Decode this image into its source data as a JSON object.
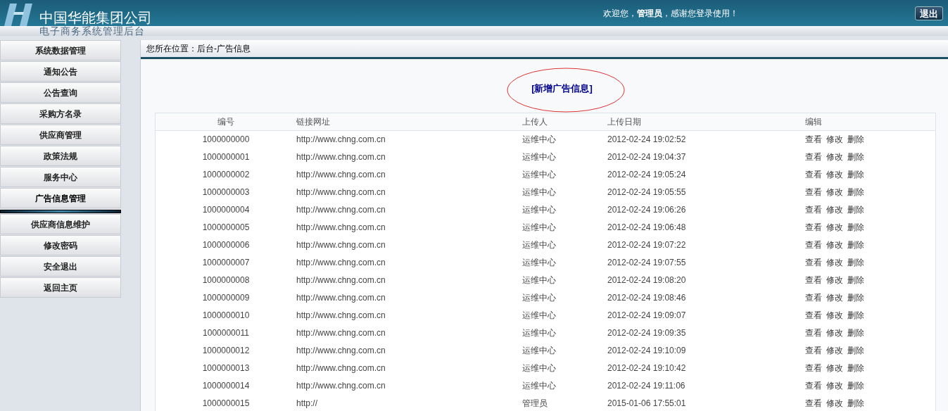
{
  "header": {
    "company": "中国华能集团公司",
    "subtitle": "电子商务系统管理后台",
    "welcome_before": "欢迎您，",
    "user": "管理员",
    "welcome_after": "，感谢您登录使用！",
    "logout": "退出"
  },
  "sidebar": {
    "items": [
      {
        "label": "系统数据管理",
        "selected": false
      },
      {
        "label": "通知公告",
        "selected": false
      },
      {
        "label": "公告查询",
        "selected": false
      },
      {
        "label": "采购方名录",
        "selected": false
      },
      {
        "label": "供应商管理",
        "selected": false
      },
      {
        "label": "政策法规",
        "selected": false
      },
      {
        "label": "服务中心",
        "selected": false
      },
      {
        "label": "广告信息管理",
        "selected": true
      },
      {
        "label": "供应商信息维护",
        "selected": false
      },
      {
        "label": "修改密码",
        "selected": false
      },
      {
        "label": "安全退出",
        "selected": false
      },
      {
        "label": "返回主页",
        "selected": false
      }
    ]
  },
  "breadcrumb": "您所在位置：后台-广告信息",
  "add_link": "[新增广告信息]",
  "table": {
    "columns": [
      "编号",
      "链接网址",
      "上传人",
      "上传日期",
      "编辑"
    ],
    "rows": [
      {
        "cells": [
          "1000000000",
          "http://www.chng.com.cn",
          "运维中心",
          "2012-02-24 19:02:52"
        ],
        "actions": [
          "查看",
          "修改",
          "删除"
        ]
      },
      {
        "cells": [
          "1000000001",
          "http://www.chng.com.cn",
          "运维中心",
          "2012-02-24 19:04:37"
        ],
        "actions": [
          "查看",
          "修改",
          "删除"
        ]
      },
      {
        "cells": [
          "1000000002",
          "http://www.chng.com.cn",
          "运维中心",
          "2012-02-24 19:05:24"
        ],
        "actions": [
          "查看",
          "修改",
          "删除"
        ]
      },
      {
        "cells": [
          "1000000003",
          "http://www.chng.com.cn",
          "运维中心",
          "2012-02-24 19:05:55"
        ],
        "actions": [
          "查看",
          "修改",
          "删除"
        ]
      },
      {
        "cells": [
          "1000000004",
          "http://www.chng.com.cn",
          "运维中心",
          "2012-02-24 19:06:26"
        ],
        "actions": [
          "查看",
          "修改",
          "删除"
        ]
      },
      {
        "cells": [
          "1000000005",
          "http://www.chng.com.cn",
          "运维中心",
          "2012-02-24 19:06:48"
        ],
        "actions": [
          "查看",
          "修改",
          "删除"
        ]
      },
      {
        "cells": [
          "1000000006",
          "http://www.chng.com.cn",
          "运维中心",
          "2012-02-24 19:07:22"
        ],
        "actions": [
          "查看",
          "修改",
          "删除"
        ]
      },
      {
        "cells": [
          "1000000007",
          "http://www.chng.com.cn",
          "运维中心",
          "2012-02-24 19:07:55"
        ],
        "actions": [
          "查看",
          "修改",
          "删除"
        ]
      },
      {
        "cells": [
          "1000000008",
          "http://www.chng.com.cn",
          "运维中心",
          "2012-02-24 19:08:20"
        ],
        "actions": [
          "查看",
          "修改",
          "删除"
        ]
      },
      {
        "cells": [
          "1000000009",
          "http://www.chng.com.cn",
          "运维中心",
          "2012-02-24 19:08:46"
        ],
        "actions": [
          "查看",
          "修改",
          "删除"
        ]
      },
      {
        "cells": [
          "1000000010",
          "http://www.chng.com.cn",
          "运维中心",
          "2012-02-24 19:09:07"
        ],
        "actions": [
          "查看",
          "修改",
          "删除"
        ]
      },
      {
        "cells": [
          "1000000011",
          "http://www.chng.com.cn",
          "运维中心",
          "2012-02-24 19:09:35"
        ],
        "actions": [
          "查看",
          "修改",
          "删除"
        ]
      },
      {
        "cells": [
          "1000000012",
          "http://www.chng.com.cn",
          "运维中心",
          "2012-02-24 19:10:09"
        ],
        "actions": [
          "查看",
          "修改",
          "删除"
        ]
      },
      {
        "cells": [
          "1000000013",
          "http://www.chng.com.cn",
          "运维中心",
          "2012-02-24 19:10:42"
        ],
        "actions": [
          "查看",
          "修改",
          "删除"
        ]
      },
      {
        "cells": [
          "1000000014",
          "http://www.chng.com.cn",
          "运维中心",
          "2012-02-24 19:11:06"
        ],
        "actions": [
          "查看",
          "修改",
          "删除"
        ]
      },
      {
        "cells": [
          "1000000015",
          "http://",
          "管理员",
          "2015-01-06 17:55:01"
        ],
        "actions": [
          "查看",
          "修改",
          "删除"
        ]
      }
    ]
  }
}
